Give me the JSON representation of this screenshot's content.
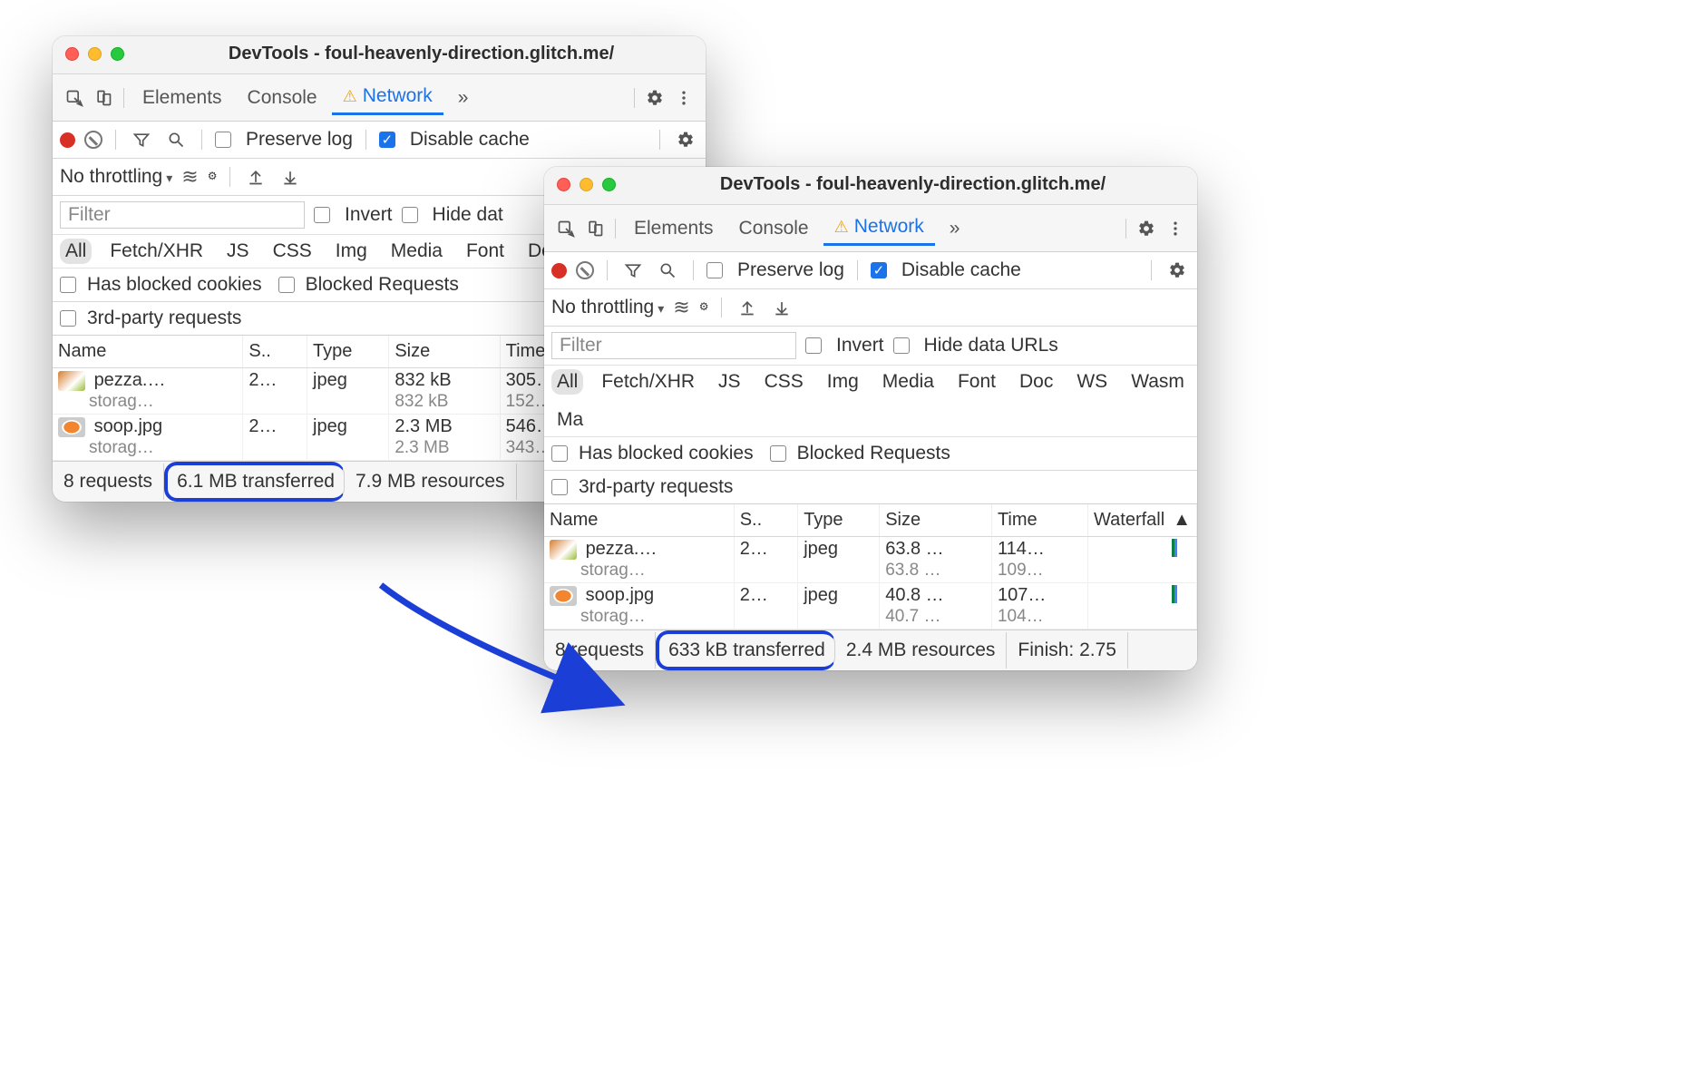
{
  "windows": {
    "title": "DevTools - foul-heavenly-direction.glitch.me/",
    "tabs": {
      "elements": "Elements",
      "console": "Console",
      "network": "Network",
      "more": "»"
    },
    "toolbar": {
      "preserve_log": "Preserve log",
      "disable_cache": "Disable cache",
      "no_throttling": "No throttling"
    },
    "filter": {
      "placeholder": "Filter",
      "invert": "Invert",
      "hide_data_short": "Hide dat",
      "hide_data_urls": "Hide data URLs"
    },
    "type_filters": [
      "All",
      "Fetch/XHR",
      "JS",
      "CSS",
      "Img",
      "Media",
      "Font",
      "Doc",
      "WS",
      "Wasm",
      "Ma"
    ],
    "extra_checks": {
      "blocked_cookies": "Has blocked cookies",
      "blocked_requests": "Blocked Requests",
      "third_party": "3rd-party requests"
    },
    "columns": {
      "name": "Name",
      "status": "S..",
      "type": "Type",
      "size": "Size",
      "time": "Time",
      "waterfall": "Waterfall"
    }
  },
  "w1": {
    "rows": [
      {
        "name": "pezza.…",
        "sub": "storag…",
        "status": "2…",
        "type": "jpeg",
        "size": "832 kB",
        "size_sub": "832 kB",
        "time": "305…",
        "time_sub": "152…"
      },
      {
        "name": "soop.jpg",
        "sub": "storag…",
        "status": "2…",
        "type": "jpeg",
        "size": "2.3 MB",
        "size_sub": "2.3 MB",
        "time": "546…",
        "time_sub": "343…"
      }
    ],
    "status": {
      "requests": "8 requests",
      "transferred": "6.1 MB transferred",
      "resources": "7.9 MB resources"
    }
  },
  "w2": {
    "rows": [
      {
        "name": "pezza.…",
        "sub": "storag…",
        "status": "2…",
        "type": "jpeg",
        "size": "63.8 …",
        "size_sub": "63.8 …",
        "time": "114…",
        "time_sub": "109…"
      },
      {
        "name": "soop.jpg",
        "sub": "storag…",
        "status": "2…",
        "type": "jpeg",
        "size": "40.8 …",
        "size_sub": "40.7 …",
        "time": "107…",
        "time_sub": "104…"
      }
    ],
    "status": {
      "requests": "8 requests",
      "transferred": "633 kB transferred",
      "resources": "2.4 MB resources",
      "finish": "Finish: 2.75"
    }
  }
}
